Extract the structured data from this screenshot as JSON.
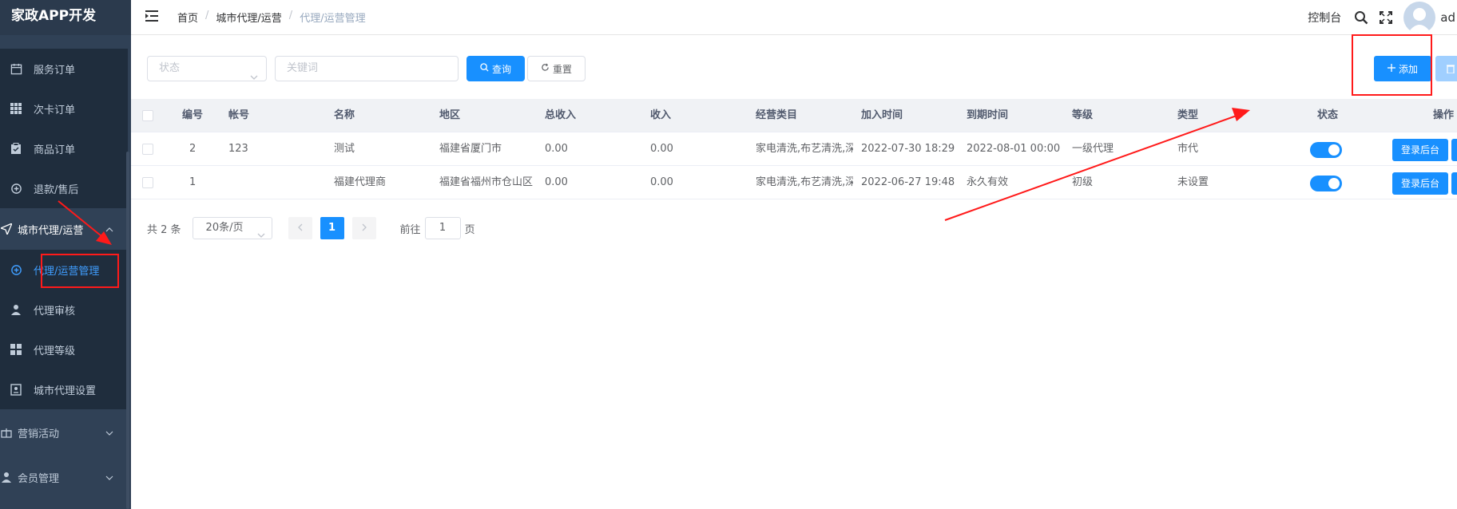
{
  "app": {
    "title": "家政APP开发"
  },
  "sidebar": {
    "items": [
      {
        "label": "服务订单",
        "icon": "calendar-icon"
      },
      {
        "label": "次卡订单",
        "icon": "grid-icon"
      },
      {
        "label": "商品订单",
        "icon": "clipboard-icon"
      },
      {
        "label": "退款/售后",
        "icon": "refund-icon"
      },
      {
        "label": "城市代理/运营",
        "icon": "send-icon"
      },
      {
        "label": "代理/运营管理",
        "icon": "refund-icon"
      },
      {
        "label": "代理审核",
        "icon": "user-icon"
      },
      {
        "label": "代理等级",
        "icon": "grid-icon"
      },
      {
        "label": "城市代理设置",
        "icon": "settings-card-icon"
      },
      {
        "label": "营销活动",
        "icon": "gift-icon"
      },
      {
        "label": "会员管理",
        "icon": "user-icon"
      }
    ]
  },
  "header": {
    "breadcrumb": [
      "首页",
      "城市代理/运营",
      "代理/运营管理"
    ],
    "separator": "/",
    "console": "控制台",
    "username": "ad"
  },
  "filters": {
    "status_placeholder": "状态",
    "keyword_placeholder": "关键词",
    "search_label": "查询",
    "reset_label": "重置",
    "add_label": "添加"
  },
  "table": {
    "columns": [
      "编号",
      "帐号",
      "名称",
      "地区",
      "总收入",
      "收入",
      "经营类目",
      "加入时间",
      "到期时间",
      "等级",
      "类型",
      "状态",
      "操作"
    ],
    "rows": [
      {
        "id": "2",
        "account": "123",
        "name": "测试",
        "region": "福建省厦门市",
        "total_income": "0.00",
        "income": "0.00",
        "category": "家电清洗,布艺清洗,深",
        "join_time": "2022-07-30 18:29",
        "expire_time": "2022-08-01 00:00",
        "level": "一级代理",
        "type": "市代",
        "status_on": true,
        "op_label": "登录后台"
      },
      {
        "id": "1",
        "account": "",
        "name": "福建代理商",
        "region": "福建省福州市仓山区",
        "total_income": "0.00",
        "income": "0.00",
        "category": "家电清洗,布艺清洗,深",
        "join_time": "2022-06-27 19:48",
        "expire_time": "永久有效",
        "level": "初级",
        "type": "未设置",
        "status_on": true,
        "op_label": "登录后台"
      }
    ]
  },
  "pagination": {
    "total": "共 2 条",
    "page_size": "20条/页",
    "current_page": "1",
    "goto_prefix": "前往",
    "goto_value": "1",
    "goto_suffix": "页"
  },
  "colors": {
    "primary": "#1890ff",
    "sidebar_bg": "#304156",
    "annotation": "#ff1a1a"
  }
}
